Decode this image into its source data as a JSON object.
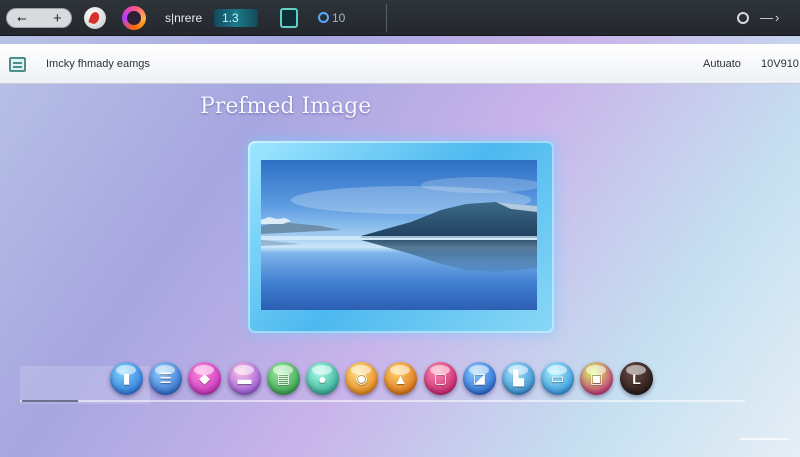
{
  "topbar": {
    "back_glyph": "⭠",
    "forward_glyph": "+",
    "search_text": "s|nrere",
    "count_text": "1.3",
    "number_text": "10",
    "menu_glyph": "—›"
  },
  "infobar": {
    "title": "Imcky fhmady eamgs",
    "mode": "Autuato",
    "size": "10V910"
  },
  "main": {
    "title": "Prefmed Image"
  },
  "dock": {
    "items": [
      {
        "name": "dock-item-1",
        "glyph": "▮",
        "color_a": "#7fd8ff",
        "color_b": "#2a6fd6"
      },
      {
        "name": "dock-item-2",
        "glyph": "☰",
        "color_a": "#9ad4ff",
        "color_b": "#2762c9"
      },
      {
        "name": "dock-item-3",
        "glyph": "◆",
        "color_a": "#ff8de0",
        "color_b": "#c42ab8"
      },
      {
        "name": "dock-item-4",
        "glyph": "▬",
        "color_a": "#ffc2e6",
        "color_b": "#8f4fd6"
      },
      {
        "name": "dock-item-5",
        "glyph": "▤",
        "color_a": "#9ff0a0",
        "color_b": "#2f9a4a"
      },
      {
        "name": "dock-item-6",
        "glyph": "●",
        "color_a": "#a7ffe8",
        "color_b": "#2aa38c"
      },
      {
        "name": "dock-item-7",
        "glyph": "◉",
        "color_a": "#ffe27a",
        "color_b": "#e27d1a"
      },
      {
        "name": "dock-item-8",
        "glyph": "▲",
        "color_a": "#ffd36b",
        "color_b": "#d86a12"
      },
      {
        "name": "dock-item-9",
        "glyph": "▢",
        "color_a": "#ff8ab0",
        "color_b": "#c21c6a"
      },
      {
        "name": "dock-item-10",
        "glyph": "◪",
        "color_a": "#8fd0ff",
        "color_b": "#1f5fcf"
      },
      {
        "name": "dock-item-11",
        "glyph": "▙",
        "color_a": "#a6e6ff",
        "color_b": "#2a84c9"
      },
      {
        "name": "dock-item-12",
        "glyph": "▭",
        "color_a": "#a8f0ff",
        "color_b": "#2b8ed8"
      },
      {
        "name": "dock-item-13",
        "glyph": "▣",
        "color_a": "#d6ff6a",
        "color_b": "#c4227c"
      },
      {
        "name": "dock-item-14",
        "glyph": "L",
        "color_a": "#6a4b45",
        "color_b": "#1f1614"
      }
    ]
  },
  "colors": {
    "accent": "#4cb8ef",
    "topbar": "#2a2e34"
  }
}
